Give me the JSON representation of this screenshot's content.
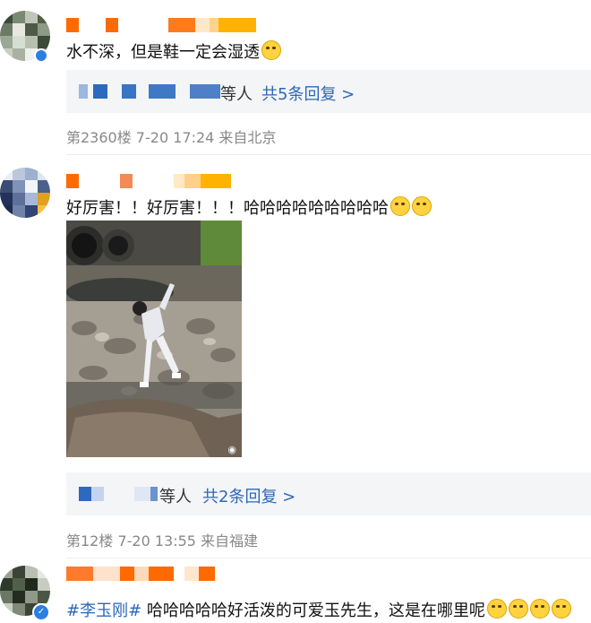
{
  "comments": [
    {
      "text": "水不深，但是鞋一定会湿透",
      "replies_suffix": "等人",
      "replies_link": "共5条回复 >",
      "meta": "第2360楼 7-20 17:24 来自北京"
    },
    {
      "text": "好厉害！！好厉害！！！哈哈哈哈哈哈哈哈哈",
      "photo_watermark": "◉",
      "replies_suffix": "等人",
      "replies_link": "共2条回复 >",
      "meta": "第12楼 7-20 13:55 来自福建"
    },
    {
      "hashtag": "#李玉刚#",
      "text": " 哈哈哈哈哈好活泼的可爱玉先生，这是在哪里呢",
      "badge": "✓"
    }
  ],
  "colors": {
    "link": "#2c68b8",
    "replybar": "#f4f5f7",
    "meta": "#888888",
    "orange": "#ff6a00"
  }
}
